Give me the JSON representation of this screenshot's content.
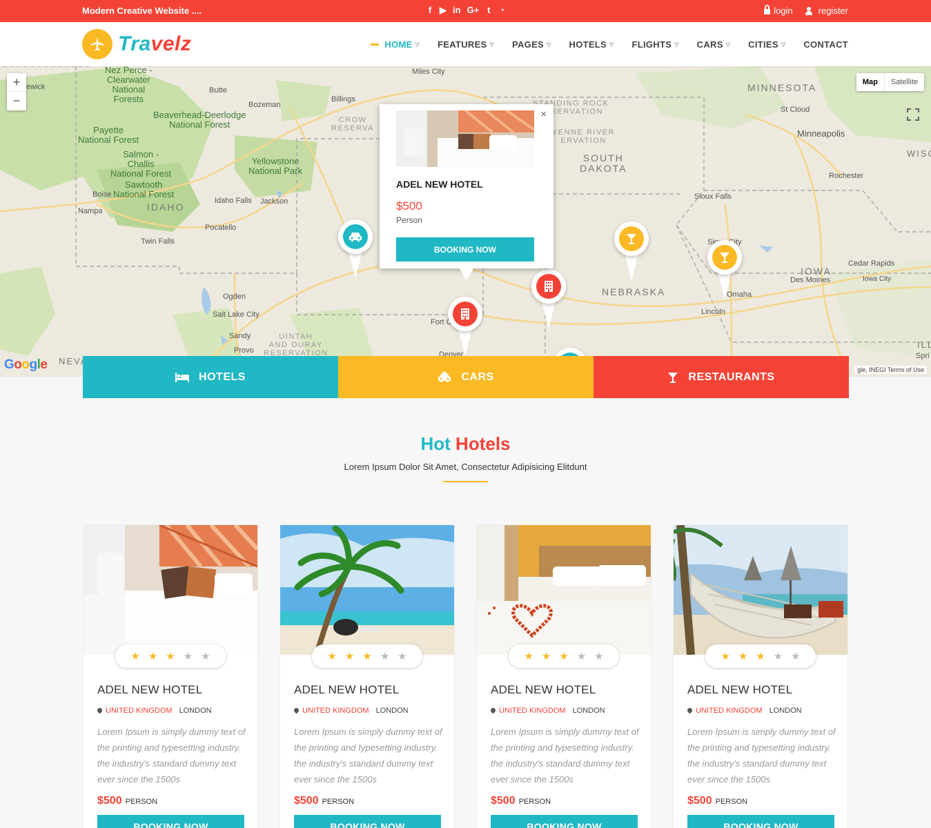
{
  "topbar": {
    "tagline": "Modern Creative Website ....",
    "social": [
      {
        "icon": "facebook-icon",
        "glyph": "f"
      },
      {
        "icon": "youtube-icon",
        "glyph": "▶"
      },
      {
        "icon": "linkedin-icon",
        "glyph": "in"
      },
      {
        "icon": "google-plus-icon",
        "glyph": "G+"
      },
      {
        "icon": "twitter-icon",
        "glyph": "t"
      },
      {
        "icon": "rss-icon",
        "glyph": "◔"
      }
    ],
    "login": "login",
    "register": "register"
  },
  "brand": {
    "part1": "Tra",
    "part2": "velz"
  },
  "nav": [
    {
      "label": "HOME",
      "active": true
    },
    {
      "label": "FEATURES"
    },
    {
      "label": "PAGES"
    },
    {
      "label": "HOTELS"
    },
    {
      "label": "FLIGHTS"
    },
    {
      "label": "CARS"
    },
    {
      "label": "CITIES"
    },
    {
      "label": "CONTACT"
    }
  ],
  "map": {
    "type_map": "Map",
    "type_satellite": "Satellite",
    "google": "Google",
    "terms": "gle, INEGI    Terms of Use",
    "labels": {
      "nezperce": "Nez Perce -\nClearwater\nNational\nForests",
      "beaverhead": "Beaverhead-Deerlodge\nNational Forest",
      "payette": "Payette\nNational Forest",
      "salmon": "Salmon -\nChallis\nNational Forest",
      "sawtooth": "Sawtooth\nNational Forest",
      "yellowstone": "Yellowstone\nNational Park",
      "idaho": "IDAHO",
      "minnesota": "MINNESOTA",
      "southdakota": "SOUTH\nDAKOTA",
      "nebraska": "NEBRASKA",
      "iowa": "IOWA",
      "standingrock": "STANDING ROCK\nRESERVATION",
      "cheyenne": "YENNE RIVER\nERVATION",
      "crow": "CROW\nRESERVA",
      "uintah": "UINTAH\nAND OURAY\nRESERVATION",
      "milescity": "Miles City",
      "butte": "Butte",
      "bozeman": "Bozeman",
      "billings": "Billings",
      "boise": "Boise",
      "nampa": "Nampa",
      "idahofalls": "Idaho Falls",
      "jackson": "Jackson",
      "pocatello": "Pocatello",
      "twinfalls": "Twin Falls",
      "ogden": "Ogden",
      "saltlake": "Salt Lake City",
      "sandy": "Sandy",
      "provo": "Provo",
      "nevada": "NEVA",
      "stcloud": "St Cloud",
      "minneapolis": "Minneapolis",
      "rochester": "Rochester",
      "siouxfalls": "Sioux Falls",
      "siouxcity": "Sioux City",
      "omaha": "Omaha",
      "lincoln": "Lincoln",
      "desmoines": "Des Moines",
      "cedarrapids": "Cedar Rapids",
      "iowacity": "Iowa City",
      "fortc": "Fort C",
      "denver": "Denver",
      "lewick": "ewick",
      "wisc": "WISC",
      "ill": "ILL",
      "spri": "Spri"
    }
  },
  "popup": {
    "name": "ADEL NEW HOTEL",
    "price": "$500",
    "per": "Person",
    "button": "BOOKING NOW",
    "close": "×"
  },
  "categories": [
    {
      "label": "HOTELS",
      "icon": "bed-icon"
    },
    {
      "label": "CARS",
      "icon": "taxi-icon"
    },
    {
      "label": "RESTAURANTS",
      "icon": "cocktail-icon"
    }
  ],
  "section": {
    "title_a": "Hot",
    "title_b": "Hotels",
    "subtitle": "Lorem Ipsum Dolor Sit Amet, Consectetur Adipisicing Elitdunt"
  },
  "cards": [
    {
      "name": "ADEL NEW HOTEL",
      "country": "UNITED KINGDOM",
      "city": "LONDON",
      "rating": 3,
      "desc": "Lorem Ipsum is simply dummy text of the printing and typesetting industry. the industry's standard dummy text ever since the 1500s",
      "price": "$500",
      "unit": "PERSON",
      "button": "BOOKING NOW"
    },
    {
      "name": "ADEL NEW HOTEL",
      "country": "UNITED KINGDOM",
      "city": "LONDON",
      "rating": 3,
      "desc": "Lorem Ipsum is simply dummy text of the printing and typesetting industry. the industry's standard dummy text ever since the 1500s",
      "price": "$500",
      "unit": "PERSON",
      "button": "BOOKING NOW"
    },
    {
      "name": "ADEL NEW HOTEL",
      "country": "UNITED KINGDOM",
      "city": "LONDON",
      "rating": 3,
      "desc": "Lorem Ipsum is simply dummy text of the printing and typesetting industry. the industry's standard dummy text ever since the 1500s",
      "price": "$500",
      "unit": "PERSON",
      "button": "BOOKING NOW"
    },
    {
      "name": "ADEL NEW HOTEL",
      "country": "UNITED KINGDOM",
      "city": "LONDON",
      "rating": 3,
      "desc": "Lorem Ipsum is simply dummy text of the printing and typesetting industry. the industry's standard dummy text ever since the 1500s",
      "price": "$500",
      "unit": "PERSON",
      "button": "BOOKING NOW"
    }
  ],
  "colors": {
    "teal": "#20b8c4",
    "yellow": "#fbb924",
    "red": "#f44336"
  }
}
